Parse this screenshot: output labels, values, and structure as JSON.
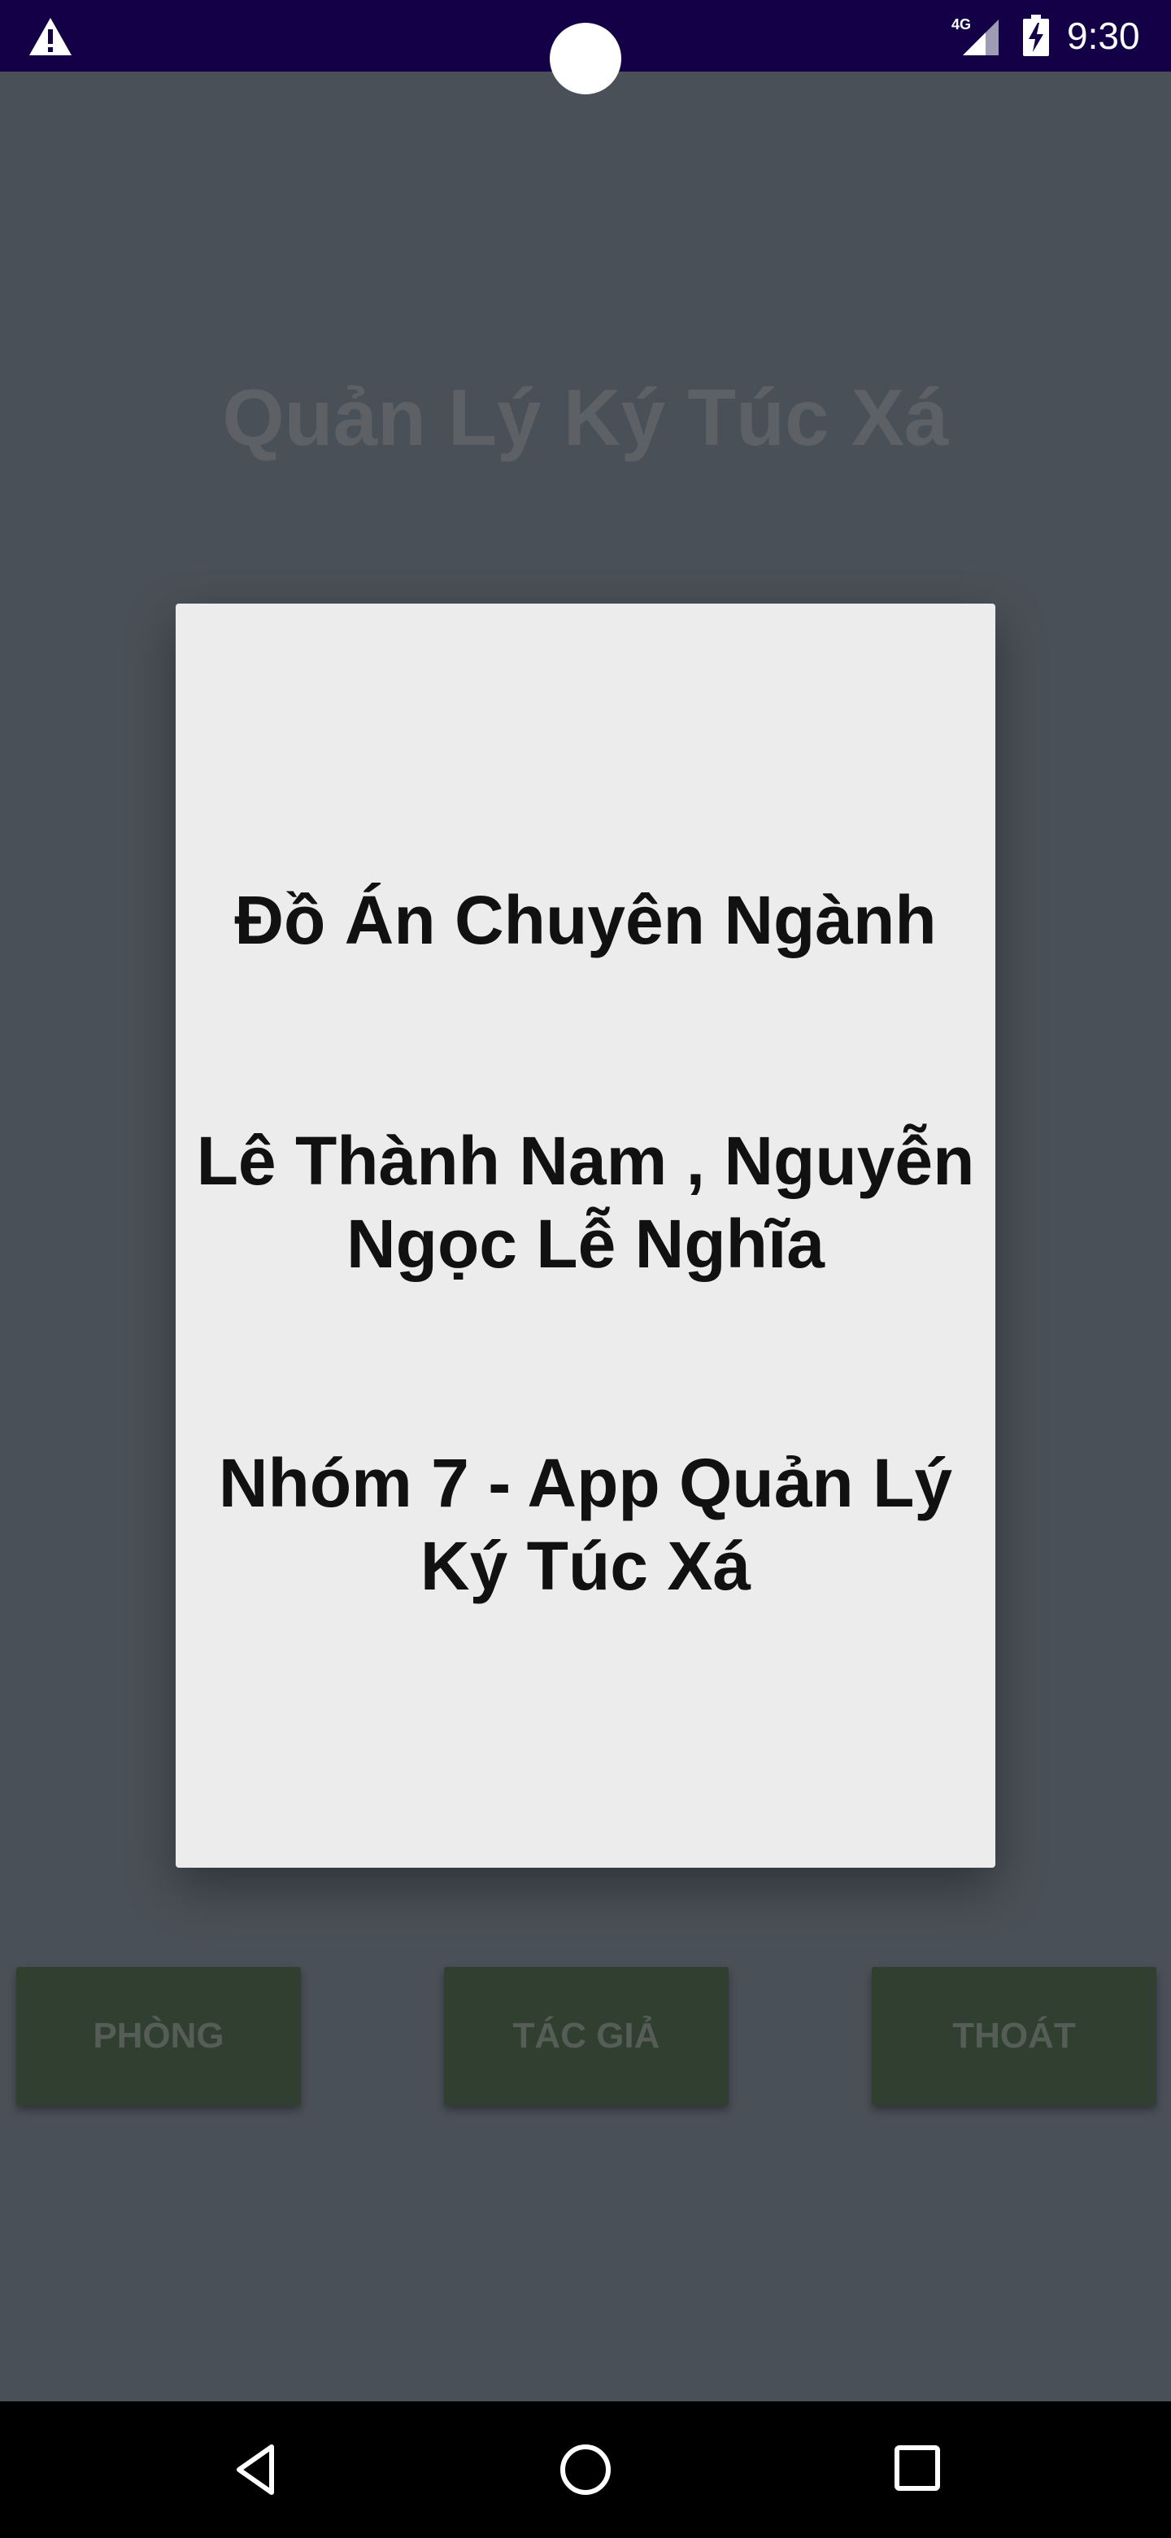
{
  "status_bar": {
    "time": "9:30",
    "network_label": "4G",
    "icons": [
      "warning-icon",
      "signal-icon",
      "battery-charging-icon"
    ]
  },
  "app": {
    "title": "Quản Lý Ký Túc Xá",
    "buttons": {
      "phong": "PHÒNG",
      "tac_gia": "TÁC GIẢ",
      "thoat": "THOÁT"
    }
  },
  "dialog": {
    "line1": "Đồ Án Chuyên Ngành",
    "line2": "Lê Thành Nam , Nguyễn Ngọc Lễ Nghĩa",
    "line3": "Nhóm 7 - App Quản Lý Ký Túc Xá"
  },
  "nav_bar": {
    "icons": [
      "back-icon",
      "home-icon",
      "recent-apps-icon"
    ]
  },
  "colors": {
    "status_bar": "#130047",
    "scrim_background": "#4a5057",
    "dialog_background": "#ececec",
    "button_background": "#313f30"
  }
}
